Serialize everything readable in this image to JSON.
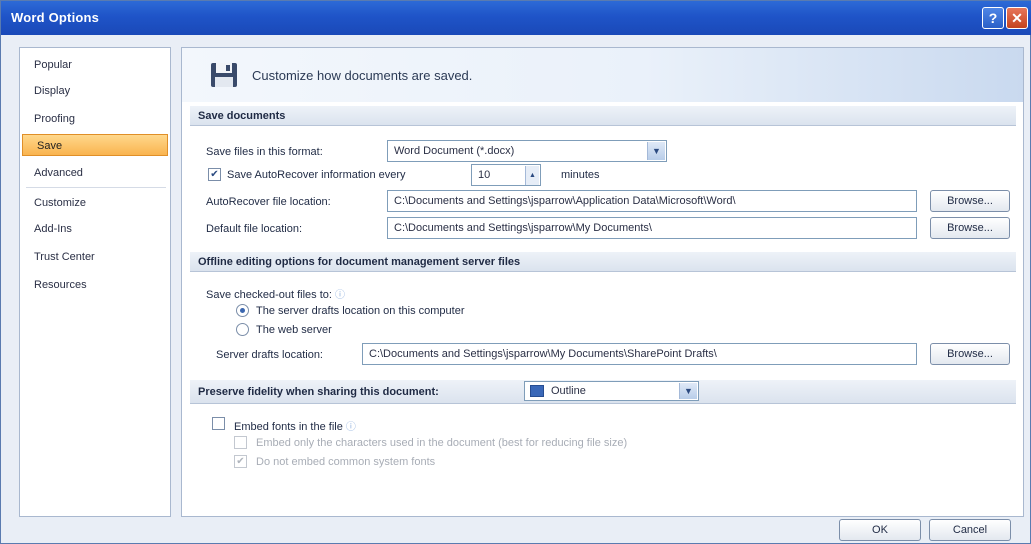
{
  "window": {
    "title": "Word Options",
    "help_glyph": "?",
    "close_glyph": "✕"
  },
  "nav": {
    "items": [
      "Popular",
      "Display",
      "Proofing",
      "Save",
      "Advanced",
      "Customize",
      "Add-Ins",
      "Trust Center",
      "Resources"
    ],
    "selected": "Save"
  },
  "header": {
    "text": "Customize how documents are saved."
  },
  "save_section": {
    "title": "Save documents",
    "format_label": "Save files in this format:",
    "format_value": "Word Document (*.docx)",
    "autorecover_label": "Save AutoRecover information every",
    "autorecover_checked": true,
    "autorecover_minutes": "10",
    "minutes_label": "minutes",
    "autorecover_location_label": "AutoRecover file location:",
    "autorecover_location_value": "C:\\Documents and Settings\\jsparrow\\Application Data\\Microsoft\\Word\\",
    "default_location_label": "Default file location:",
    "default_location_value": "C:\\Documents and Settings\\jsparrow\\My Documents\\",
    "browse_label": "Browse..."
  },
  "offline_section": {
    "title": "Offline editing options for document management server files",
    "checked_out_label": "Save checked-out files to:",
    "option_server_drafts": "The server drafts location on this computer",
    "option_web_server": "The web server",
    "selected_option": "The server drafts location on this computer",
    "drafts_location_label": "Server drafts location:",
    "drafts_location_value": "C:\\Documents and Settings\\jsparrow\\My Documents\\SharePoint Drafts\\",
    "browse_label": "Browse..."
  },
  "fidelity_section": {
    "title": "Preserve fidelity when sharing this document:",
    "document_value": "Outline",
    "embed_fonts_label": "Embed fonts in the file",
    "embed_fonts_checked": false,
    "embed_only_used_label": "Embed only the characters used in the document (best for reducing file size)",
    "no_common_fonts_label": "Do not embed common system fonts",
    "no_common_fonts_checked": true
  },
  "footer": {
    "ok_label": "OK",
    "cancel_label": "Cancel"
  },
  "icons": {
    "save": "floppy-disk-icon",
    "dropdown": "chevron-down-icon",
    "info": "info-icon",
    "check": "✔"
  }
}
